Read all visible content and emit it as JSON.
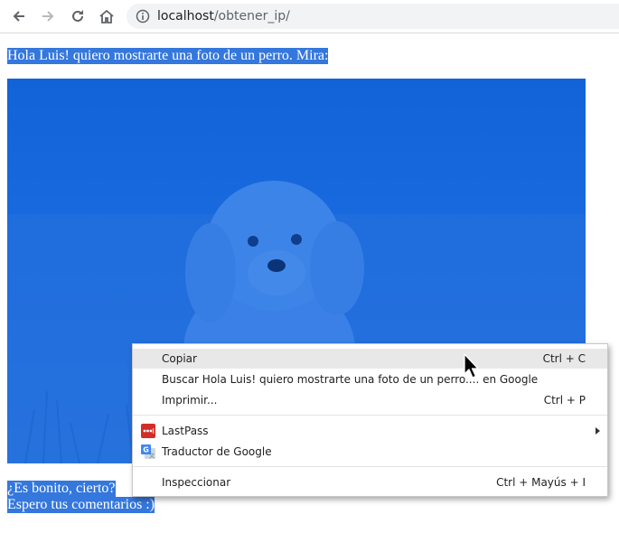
{
  "browser": {
    "url_host": "localhost",
    "url_path": "/obtener_ip/"
  },
  "page": {
    "line1": "Hola Luis! quiero mostrarte una foto de un perro. Mira:",
    "line2": "¿Es bonito, cierto?",
    "line3": "Espero tus comentarios :)"
  },
  "context_menu": {
    "items": [
      {
        "label": "Copiar",
        "shortcut": "Ctrl + C"
      },
      {
        "label": "Buscar Hola Luis! quiero mostrarte una foto de un perro.... en Google",
        "shortcut": ""
      },
      {
        "label": "Imprimir...",
        "shortcut": "Ctrl + P"
      },
      {
        "label": "LastPass",
        "shortcut": ""
      },
      {
        "label": "Traductor de Google",
        "shortcut": ""
      },
      {
        "label": "Inspeccionar",
        "shortcut": "Ctrl + Mayús + I"
      }
    ]
  },
  "colors": {
    "selection": "#3477dd",
    "photo_tint": "#1a68dd",
    "lastpass": "#d32d27",
    "google_translate": "#4285f4"
  }
}
